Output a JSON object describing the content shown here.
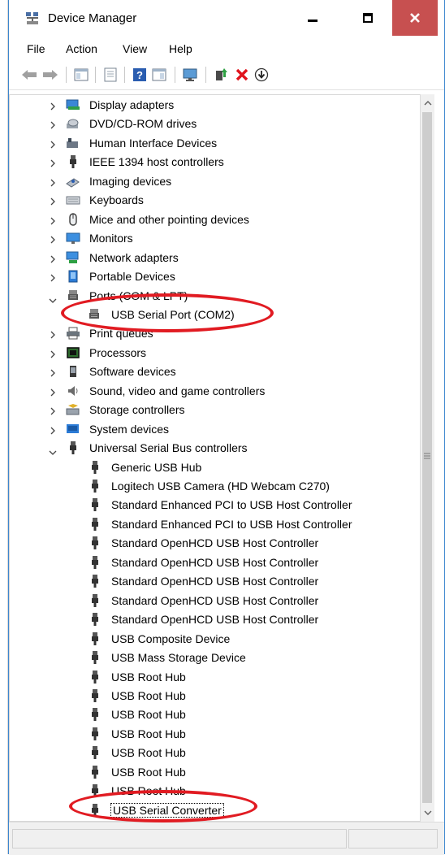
{
  "window": {
    "title": "Device Manager"
  },
  "menu": {
    "items": [
      "File",
      "Action",
      "View",
      "Help"
    ]
  },
  "tree": {
    "categories": [
      {
        "label": "Display adapters",
        "icon": "display-icon"
      },
      {
        "label": "DVD/CD-ROM drives",
        "icon": "disc-icon"
      },
      {
        "label": "Human Interface Devices",
        "icon": "hid-icon"
      },
      {
        "label": "IEEE 1394 host controllers",
        "icon": "usb-plug-icon"
      },
      {
        "label": "Imaging devices",
        "icon": "camera-icon"
      },
      {
        "label": "Keyboards",
        "icon": "keyboard-icon"
      },
      {
        "label": "Mice and other pointing devices",
        "icon": "mouse-icon"
      },
      {
        "label": "Monitors",
        "icon": "monitor-icon"
      },
      {
        "label": "Network adapters",
        "icon": "network-icon"
      },
      {
        "label": "Portable Devices",
        "icon": "portable-icon"
      },
      {
        "label": "Ports (COM & LPT)",
        "icon": "port-icon"
      },
      {
        "label": "USB Serial Port (COM2)",
        "icon": "port-icon"
      },
      {
        "label": "Print queues",
        "icon": "printer-icon"
      },
      {
        "label": "Processors",
        "icon": "chip-icon"
      },
      {
        "label": "Software devices",
        "icon": "software-icon"
      },
      {
        "label": "Sound, video and game controllers",
        "icon": "speaker-icon"
      },
      {
        "label": "Storage controllers",
        "icon": "storage-icon"
      },
      {
        "label": "System devices",
        "icon": "system-icon"
      },
      {
        "label": "Universal Serial Bus controllers",
        "icon": "usb-plug-icon"
      }
    ],
    "usb_children": [
      "Generic USB Hub",
      "Logitech USB Camera (HD Webcam C270)",
      "Standard Enhanced PCI to USB Host Controller",
      "Standard Enhanced PCI to USB Host Controller",
      "Standard OpenHCD USB Host Controller",
      "Standard OpenHCD USB Host Controller",
      "Standard OpenHCD USB Host Controller",
      "Standard OpenHCD USB Host Controller",
      "Standard OpenHCD USB Host Controller",
      "USB Composite Device",
      "USB Mass Storage Device",
      "USB Root Hub",
      "USB Root Hub",
      "USB Root Hub",
      "USB Root Hub",
      "USB Root Hub",
      "USB Root Hub",
      "USB Root Hub",
      "USB Serial Converter"
    ]
  },
  "colors": {
    "highlight_oval": "#e11b22",
    "close_button": "#c75050",
    "window_border": "#3c86cf"
  }
}
